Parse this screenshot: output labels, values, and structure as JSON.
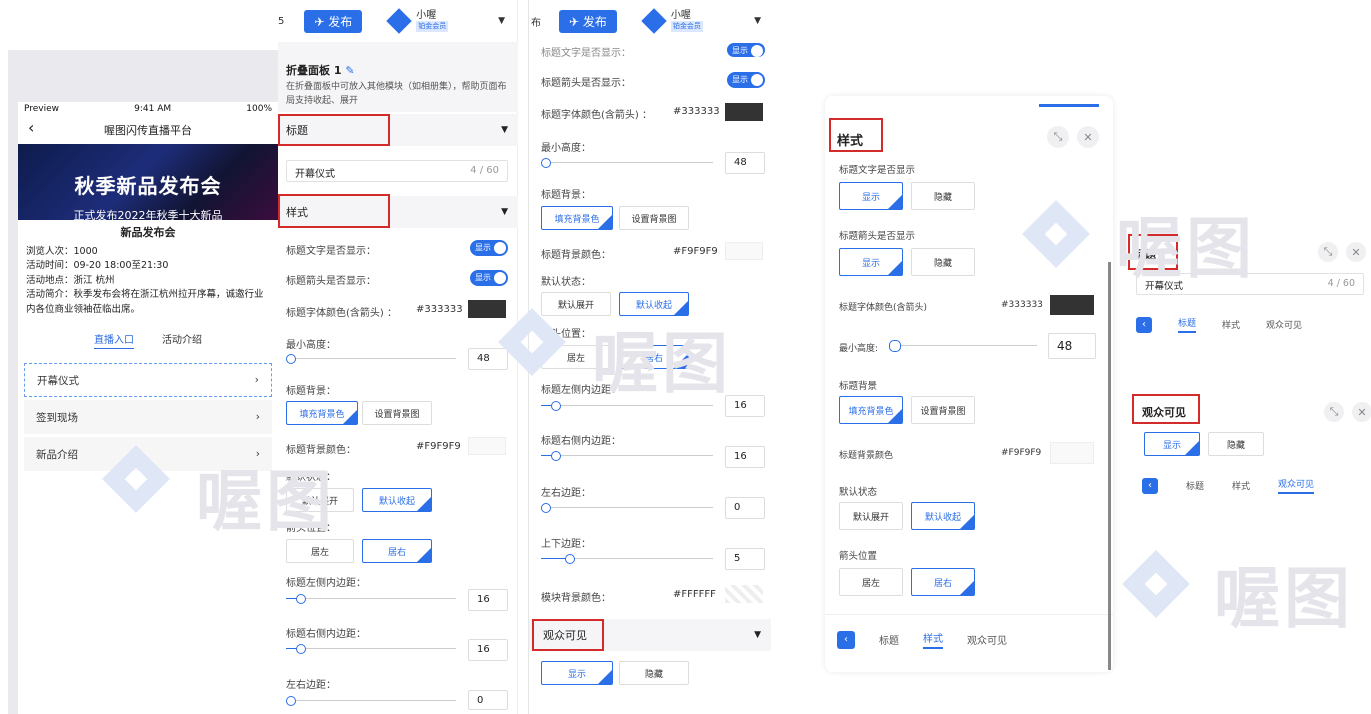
{
  "phone": {
    "status": {
      "carrier": "Preview",
      "time": "9:41 AM",
      "battery": "100%"
    },
    "nav_title": "喔图闪传直播平台",
    "banner": {
      "title": "秋季新品发布会",
      "subtitle": "正式发布2022年秋季十大新品"
    },
    "info": {
      "title": "新品发布会",
      "views": "浏览人次：1000",
      "time": "活动时间：09-20 18:00至21:30",
      "place": "活动地点：浙江 杭州",
      "intro": "活动简介：秋季发布会将在浙江杭州拉开序幕，诚邀行业内各位商业领袖莅临出席。"
    },
    "tabs": [
      "直播入口",
      "活动介绍"
    ],
    "items": [
      "开幕仪式",
      "签到现场",
      "新品介绍"
    ]
  },
  "topbar": {
    "publish": "发布",
    "user": "小喔",
    "vip": "铂金会员",
    "cut": "5",
    "cut2": "布"
  },
  "p1": {
    "panel_title": "折叠面板 1",
    "desc": "在折叠面板中可放入其他模块（如相册集），帮助页面布局支持收起、展开",
    "sec_title": "标题",
    "title_value": "开幕仪式",
    "title_count": "4 / 60",
    "sec_style": "样式",
    "show_text": "标题文字是否显示：",
    "show_arrow": "标题箭头是否显示：",
    "toggle": "显示",
    "font_color": "标题字体颜色(含箭头) ：",
    "font_color_val": "#333333",
    "min_h": "最小高度：",
    "min_h_val": "48",
    "bg": "标题背景：",
    "bg_fill": "填充背景色",
    "bg_img": "设置背景图",
    "bg_color": "标题背景颜色：",
    "bg_color_val": "#F9F9F9",
    "default": "默认状态：",
    "expand": "默认展开",
    "collapse": "默认收起",
    "arrow_pos": "箭头位置：",
    "left": "居左",
    "right": "居右",
    "lpad": "标题左侧内边距：",
    "lpad_val": "16",
    "rpad": "标题右侧内边距：",
    "rpad_val": "16",
    "lr": "左右边距：",
    "lr_val": "0"
  },
  "p2": {
    "show_text": "标题文字是否显示：",
    "show_arrow": "标题箭头是否显示：",
    "toggle": "显示",
    "font_color": "标题字体颜色(含箭头) ：",
    "font_color_val": "#333333",
    "min_h": "最小高度：",
    "min_h_val": "48",
    "bg": "标题背景：",
    "bg_fill": "填充背景色",
    "bg_img": "设置背景图",
    "bg_color": "标题背景颜色：",
    "bg_color_val": "#F9F9F9",
    "default": "默认状态：",
    "expand": "默认展开",
    "collapse": "默认收起",
    "arrow_pos": "箭头位置：",
    "left": "居左",
    "right": "居右",
    "lpad": "标题左侧内边距：",
    "lpad_val": "16",
    "rpad": "标题右侧内边距：",
    "rpad_val": "16",
    "lr": "左右边距：",
    "lr_val": "0",
    "tb": "上下边距：",
    "tb_val": "5",
    "mod_bg": "模块背景颜色：",
    "mod_bg_val": "#FFFFFF",
    "sec_vis": "观众可见",
    "show": "显示",
    "hide": "隐藏"
  },
  "p3": {
    "title": "样式",
    "show_text": "标题文字是否显示",
    "show_arrow": "标题箭头是否显示",
    "show": "显示",
    "hide": "隐藏",
    "font_color": "标题字体颜色(含箭头)",
    "font_color_val": "#333333",
    "min_h": "最小高度:",
    "min_h_val": "48",
    "bg": "标题背景",
    "bg_fill": "填充背景色",
    "bg_img": "设置背景图",
    "bg_color": "标题背景颜色",
    "bg_color_val": "#F9F9F9",
    "default": "默认状态",
    "expand": "默认展开",
    "collapse": "默认收起",
    "arrow_pos": "箭头位置",
    "left": "居左",
    "right": "居右",
    "tabs": [
      "标题",
      "样式",
      "观众可见"
    ]
  },
  "p4": {
    "title": "标题",
    "title_value": "开幕仪式",
    "title_count": "4 / 60",
    "tabs": [
      "标题",
      "样式",
      "观众可见"
    ],
    "vis_title": "观众可见",
    "show": "显示",
    "hide": "隐藏"
  },
  "watermark": "喔图"
}
